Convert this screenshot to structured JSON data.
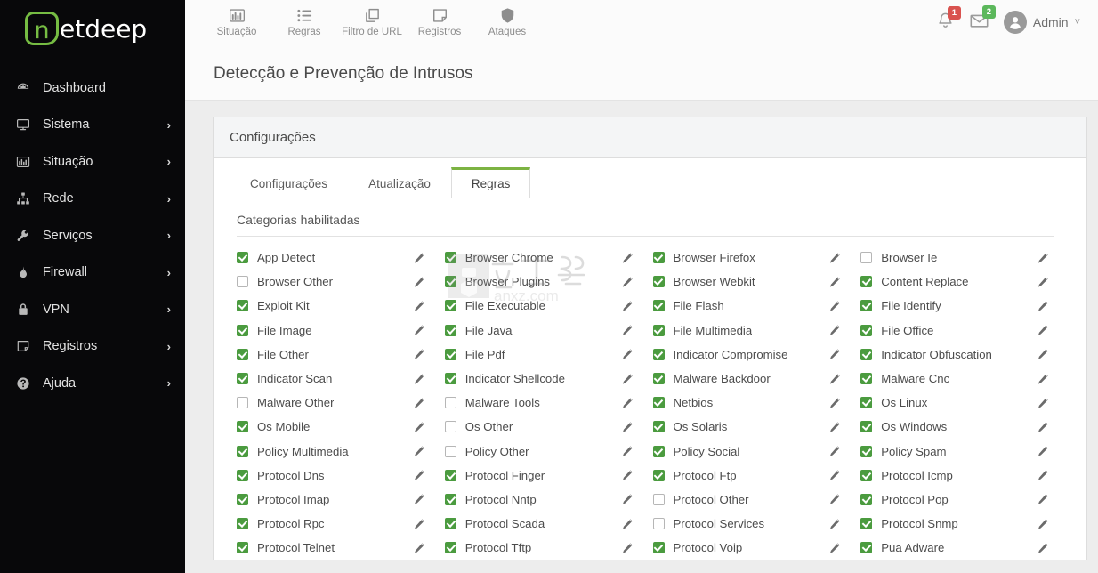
{
  "brand": {
    "logo_mark_letter": "n",
    "logo_text": "etdeep",
    "logo_color": "#76bc43"
  },
  "sidebar": {
    "items": [
      {
        "label": "Dashboard",
        "icon": "dashboard-icon",
        "chevron": ""
      },
      {
        "label": "Sistema",
        "icon": "monitor-icon",
        "chevron": "›"
      },
      {
        "label": "Situação",
        "icon": "bar-chart-icon",
        "chevron": "›"
      },
      {
        "label": "Rede",
        "icon": "sitemap-icon",
        "chevron": "›"
      },
      {
        "label": "Serviços",
        "icon": "wrench-icon",
        "chevron": "›"
      },
      {
        "label": "Firewall",
        "icon": "flame-icon",
        "chevron": "›"
      },
      {
        "label": "VPN",
        "icon": "lock-icon",
        "chevron": "›"
      },
      {
        "label": "Registros",
        "icon": "note-icon",
        "chevron": "›"
      },
      {
        "label": "Ajuda",
        "icon": "help-icon",
        "chevron": "›"
      }
    ]
  },
  "topbar": {
    "tools": [
      {
        "label": "Situação",
        "icon": "bar-chart-icon"
      },
      {
        "label": "Regras",
        "icon": "list-icon"
      },
      {
        "label": "Filtro de URL",
        "icon": "copy-pages-icon"
      },
      {
        "label": "Registros",
        "icon": "note-icon"
      },
      {
        "label": "Ataques",
        "icon": "shield-icon"
      }
    ],
    "notifications": {
      "icon": "bell-icon",
      "count": "1",
      "color": "#d9534f"
    },
    "messages": {
      "icon": "envelope-icon",
      "count": "2",
      "color": "#5cb85c"
    },
    "user": {
      "icon": "user-avatar-icon",
      "name": "Admin",
      "caret": "˅"
    }
  },
  "page": {
    "title": "Detecção e Prevenção de Intrusos"
  },
  "panel": {
    "header": "Configurações",
    "tabs": [
      {
        "label": "Configurações",
        "active": false
      },
      {
        "label": "Atualização",
        "active": false
      },
      {
        "label": "Regras",
        "active": true
      }
    ],
    "active_tab_accent": "#7cb342",
    "section_title": "Categorias habilitadas",
    "edit_icon": "pencil-icon",
    "checkbox_on_color": "#4b9b3f",
    "categories": [
      {
        "label": "App Detect",
        "checked": true
      },
      {
        "label": "Browser Chrome",
        "checked": true
      },
      {
        "label": "Browser Firefox",
        "checked": true
      },
      {
        "label": "Browser Ie",
        "checked": false
      },
      {
        "label": "Browser Other",
        "checked": false
      },
      {
        "label": "Browser Plugins",
        "checked": true
      },
      {
        "label": "Browser Webkit",
        "checked": true
      },
      {
        "label": "Content Replace",
        "checked": true
      },
      {
        "label": "Exploit Kit",
        "checked": true
      },
      {
        "label": "File Executable",
        "checked": true
      },
      {
        "label": "File Flash",
        "checked": true
      },
      {
        "label": "File Identify",
        "checked": true
      },
      {
        "label": "File Image",
        "checked": true
      },
      {
        "label": "File Java",
        "checked": true
      },
      {
        "label": "File Multimedia",
        "checked": true
      },
      {
        "label": "File Office",
        "checked": true
      },
      {
        "label": "File Other",
        "checked": true
      },
      {
        "label": "File Pdf",
        "checked": true
      },
      {
        "label": "Indicator Compromise",
        "checked": true
      },
      {
        "label": "Indicator Obfuscation",
        "checked": true
      },
      {
        "label": "Indicator Scan",
        "checked": true
      },
      {
        "label": "Indicator Shellcode",
        "checked": true
      },
      {
        "label": "Malware Backdoor",
        "checked": true
      },
      {
        "label": "Malware Cnc",
        "checked": true
      },
      {
        "label": "Malware Other",
        "checked": false
      },
      {
        "label": "Malware Tools",
        "checked": false
      },
      {
        "label": "Netbios",
        "checked": true
      },
      {
        "label": "Os Linux",
        "checked": true
      },
      {
        "label": "Os Mobile",
        "checked": true
      },
      {
        "label": "Os Other",
        "checked": false
      },
      {
        "label": "Os Solaris",
        "checked": true
      },
      {
        "label": "Os Windows",
        "checked": true
      },
      {
        "label": "Policy Multimedia",
        "checked": true
      },
      {
        "label": "Policy Other",
        "checked": false
      },
      {
        "label": "Policy Social",
        "checked": true
      },
      {
        "label": "Policy Spam",
        "checked": true
      },
      {
        "label": "Protocol Dns",
        "checked": true
      },
      {
        "label": "Protocol Finger",
        "checked": true
      },
      {
        "label": "Protocol Ftp",
        "checked": true
      },
      {
        "label": "Protocol Icmp",
        "checked": true
      },
      {
        "label": "Protocol Imap",
        "checked": true
      },
      {
        "label": "Protocol Nntp",
        "checked": true
      },
      {
        "label": "Protocol Other",
        "checked": false
      },
      {
        "label": "Protocol Pop",
        "checked": true
      },
      {
        "label": "Protocol Rpc",
        "checked": true
      },
      {
        "label": "Protocol Scada",
        "checked": true
      },
      {
        "label": "Protocol Services",
        "checked": false
      },
      {
        "label": "Protocol Snmp",
        "checked": true
      },
      {
        "label": "Protocol Telnet",
        "checked": true
      },
      {
        "label": "Protocol Tftp",
        "checked": true
      },
      {
        "label": "Protocol Voip",
        "checked": true
      },
      {
        "label": "Pua Adware",
        "checked": true
      }
    ]
  },
  "watermark": {
    "text_cn": "安下载",
    "text_url": "anxz.com"
  }
}
